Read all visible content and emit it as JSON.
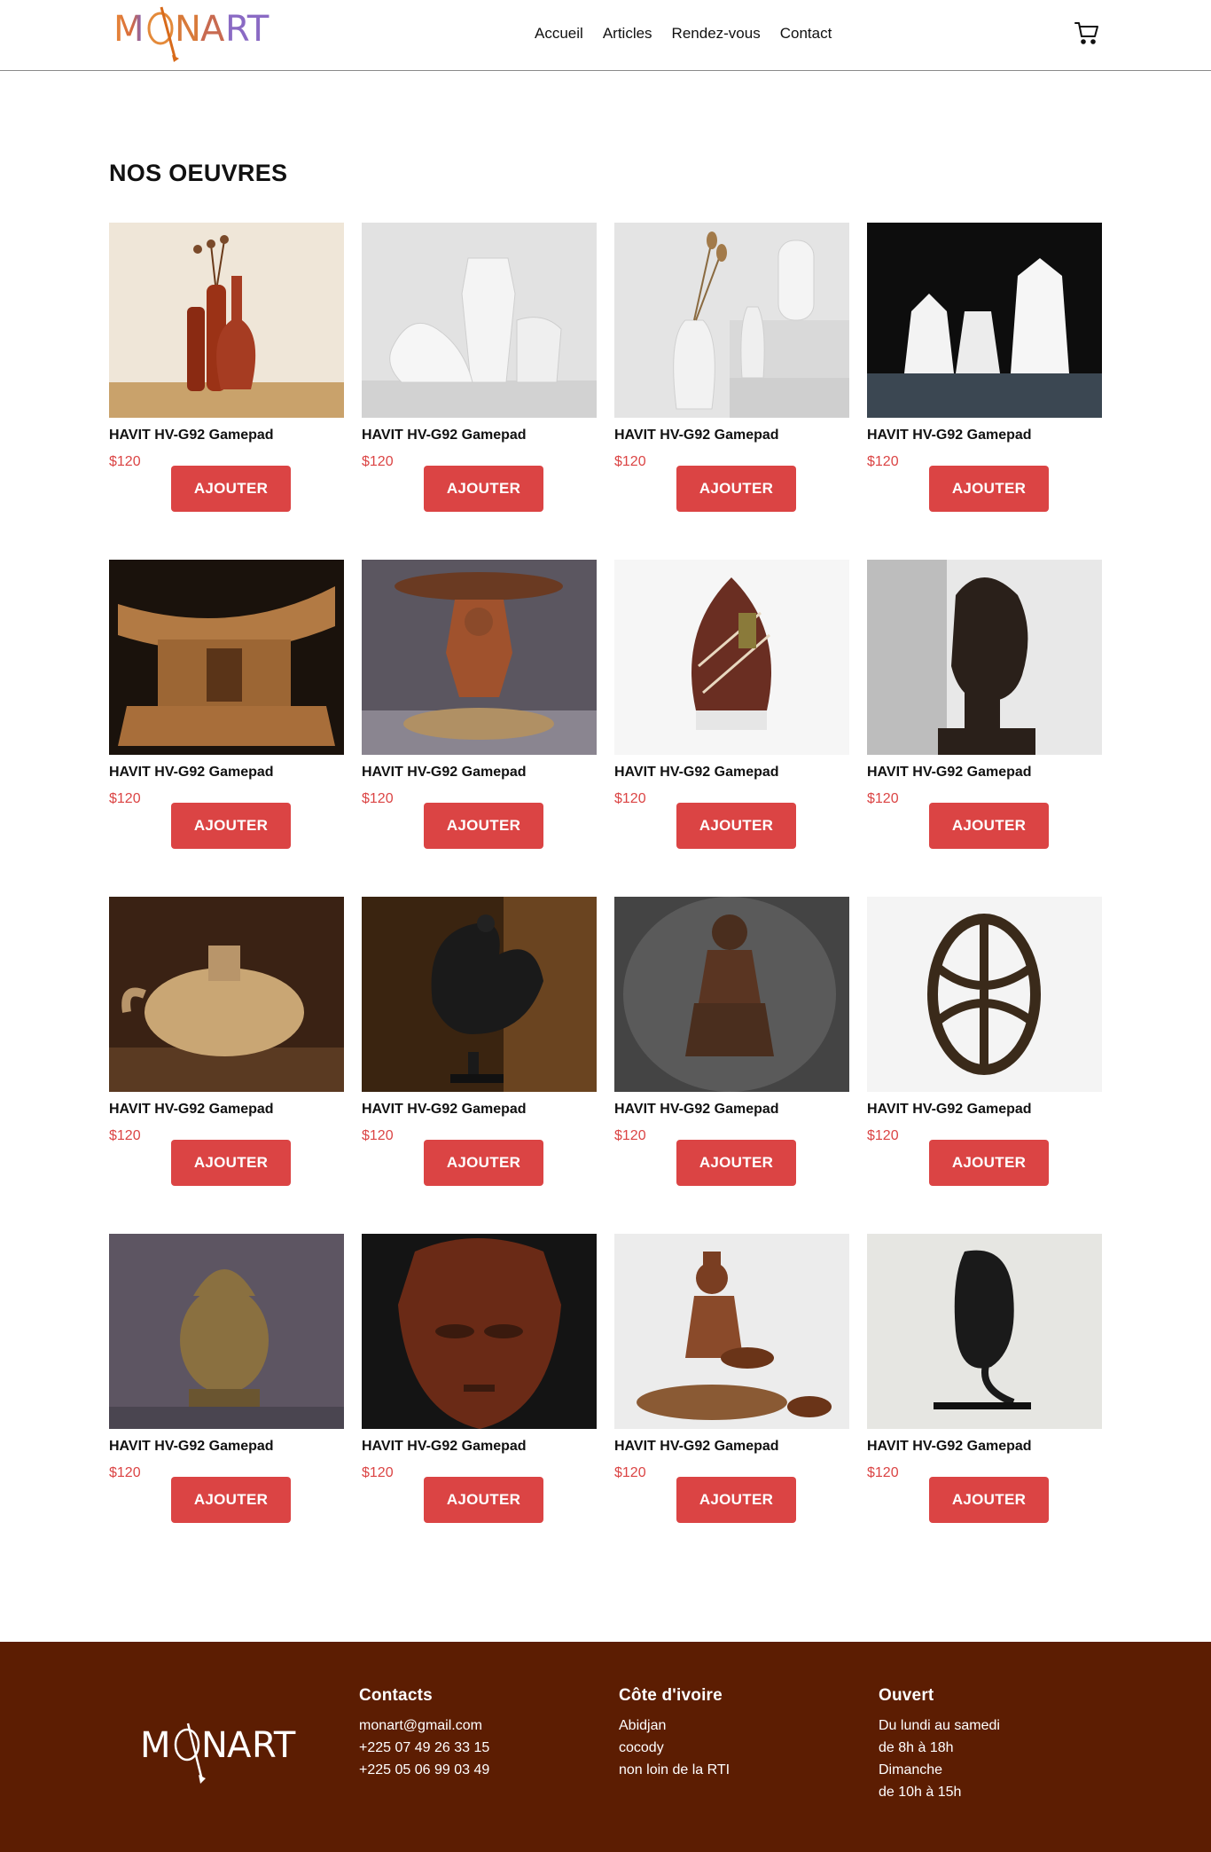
{
  "header": {
    "logo_text": "MONART",
    "nav": [
      "Accueil",
      "Articles",
      "Rendez-vous",
      "Contact"
    ],
    "cart_icon": "cart-icon"
  },
  "main": {
    "section_title": "NOS OEUVRES",
    "products": [
      {
        "title": "HAVIT HV-G92 Gamepad",
        "price": "$120",
        "button": "AJOUTER",
        "image": "terracotta-vases"
      },
      {
        "title": "HAVIT HV-G92 Gamepad",
        "price": "$120",
        "button": "AJOUTER",
        "image": "white-ceramic-vases"
      },
      {
        "title": "HAVIT HV-G92 Gamepad",
        "price": "$120",
        "button": "AJOUTER",
        "image": "white-vases-dried-flowers"
      },
      {
        "title": "HAVIT HV-G92 Gamepad",
        "price": "$120",
        "button": "AJOUTER",
        "image": "geometric-white-vases"
      },
      {
        "title": "HAVIT HV-G92 Gamepad",
        "price": "$120",
        "button": "AJOUTER",
        "image": "wooden-ashanti-stool"
      },
      {
        "title": "HAVIT HV-G92 Gamepad",
        "price": "$120",
        "button": "AJOUTER",
        "image": "carved-figure-stool"
      },
      {
        "title": "HAVIT HV-G92 Gamepad",
        "price": "$120",
        "button": "AJOUTER",
        "image": "chocolate-egg-sculpture"
      },
      {
        "title": "HAVIT HV-G92 Gamepad",
        "price": "$120",
        "button": "AJOUTER",
        "image": "dark-wooden-head"
      },
      {
        "title": "HAVIT HV-G92 Gamepad",
        "price": "$120",
        "button": "AJOUTER",
        "image": "clay-pot"
      },
      {
        "title": "HAVIT HV-G92 Gamepad",
        "price": "$120",
        "button": "AJOUTER",
        "image": "bronze-rooster"
      },
      {
        "title": "HAVIT HV-G92 Gamepad",
        "price": "$120",
        "button": "AJOUTER",
        "image": "kneeling-figure"
      },
      {
        "title": "HAVIT HV-G92 Gamepad",
        "price": "$120",
        "button": "AJOUTER",
        "image": "lattice-egg"
      },
      {
        "title": "HAVIT HV-G92 Gamepad",
        "price": "$120",
        "button": "AJOUTER",
        "image": "bronze-ife-head"
      },
      {
        "title": "HAVIT HV-G92 Gamepad",
        "price": "$120",
        "button": "AJOUTER",
        "image": "wooden-mask"
      },
      {
        "title": "HAVIT HV-G92 Gamepad",
        "price": "$120",
        "button": "AJOUTER",
        "image": "seated-figure-bowl"
      },
      {
        "title": "HAVIT HV-G92 Gamepad",
        "price": "$120",
        "button": "AJOUTER",
        "image": "black-mask-on-stand"
      }
    ]
  },
  "footer": {
    "logo_text": "MONART",
    "contacts": {
      "title": "Contacts",
      "lines": [
        "monart@gmail.com",
        "+225 07 49 26 33 15",
        "+225 05 06 99 03 49"
      ]
    },
    "location": {
      "title": "Côte d'ivoire",
      "lines": [
        "Abidjan",
        "cocody",
        "non loin de la RTI"
      ]
    },
    "hours": {
      "title": "Ouvert",
      "lines": [
        "Du lundi au samedi",
        "de 8h à 18h",
        "Dimanche",
        "de 10h à 15h"
      ]
    }
  },
  "colors": {
    "accent": "#db4444",
    "footer_bg": "#5c1d02"
  }
}
